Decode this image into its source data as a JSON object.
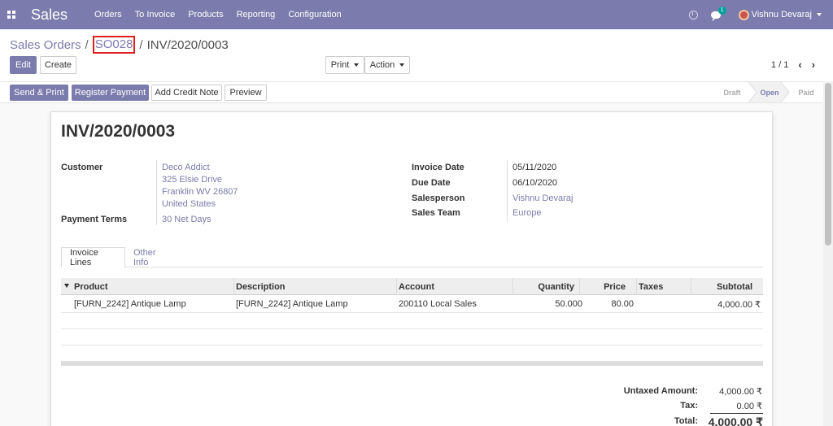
{
  "navbar": {
    "app_title": "Sales",
    "menu": [
      "Orders",
      "To Invoice",
      "Products",
      "Reporting",
      "Configuration"
    ],
    "chat_count": "1",
    "user_name": "Vishnu Devaraj"
  },
  "breadcrumb": {
    "root": "Sales Orders",
    "sep": "/",
    "order": "SO028",
    "current": "INV/2020/0003"
  },
  "buttons": {
    "edit": "Edit",
    "create": "Create",
    "print": "Print",
    "action": "Action",
    "send_print": "Send & Print",
    "register_payment": "Register Payment",
    "add_credit_note": "Add Credit Note",
    "preview": "Preview"
  },
  "pager": {
    "value": "1 / 1"
  },
  "statusbar": {
    "draft": "Draft",
    "open": "Open",
    "paid": "Paid"
  },
  "invoice": {
    "title": "INV/2020/0003",
    "customer_label": "Customer",
    "customer_name": "Deco Addict",
    "address_line1": "325 Elsie Drive",
    "address_line2": "Franklin WV 26807",
    "address_line3": "United States",
    "payment_terms_label": "Payment Terms",
    "payment_terms": "30 Net Days",
    "invoice_date_label": "Invoice Date",
    "invoice_date": "05/11/2020",
    "due_date_label": "Due Date",
    "due_date": "06/10/2020",
    "salesperson_label": "Salesperson",
    "salesperson": "Vishnu Devaraj",
    "sales_team_label": "Sales Team",
    "sales_team": "Europe"
  },
  "tabs": {
    "invoice_lines": "Invoice Lines",
    "other_info": "Other Info"
  },
  "table": {
    "headers": {
      "product": "Product",
      "description": "Description",
      "account": "Account",
      "quantity": "Quantity",
      "price": "Price",
      "taxes": "Taxes",
      "subtotal": "Subtotal"
    },
    "rows": [
      {
        "product": "[FURN_2242] Antique Lamp",
        "description": "[FURN_2242] Antique Lamp",
        "account": "200110 Local Sales",
        "quantity": "50.000",
        "price": "80.00",
        "taxes": "",
        "subtotal": "4,000.00 ₹"
      }
    ]
  },
  "totals": {
    "untaxed_label": "Untaxed Amount:",
    "untaxed": "4,000.00 ₹",
    "tax_label": "Tax:",
    "tax": "0.00 ₹",
    "total_label": "Total:",
    "total": "4,000.00 ₹"
  },
  "colors": {
    "brand": "#7c7bad",
    "highlight": "#e02020"
  }
}
